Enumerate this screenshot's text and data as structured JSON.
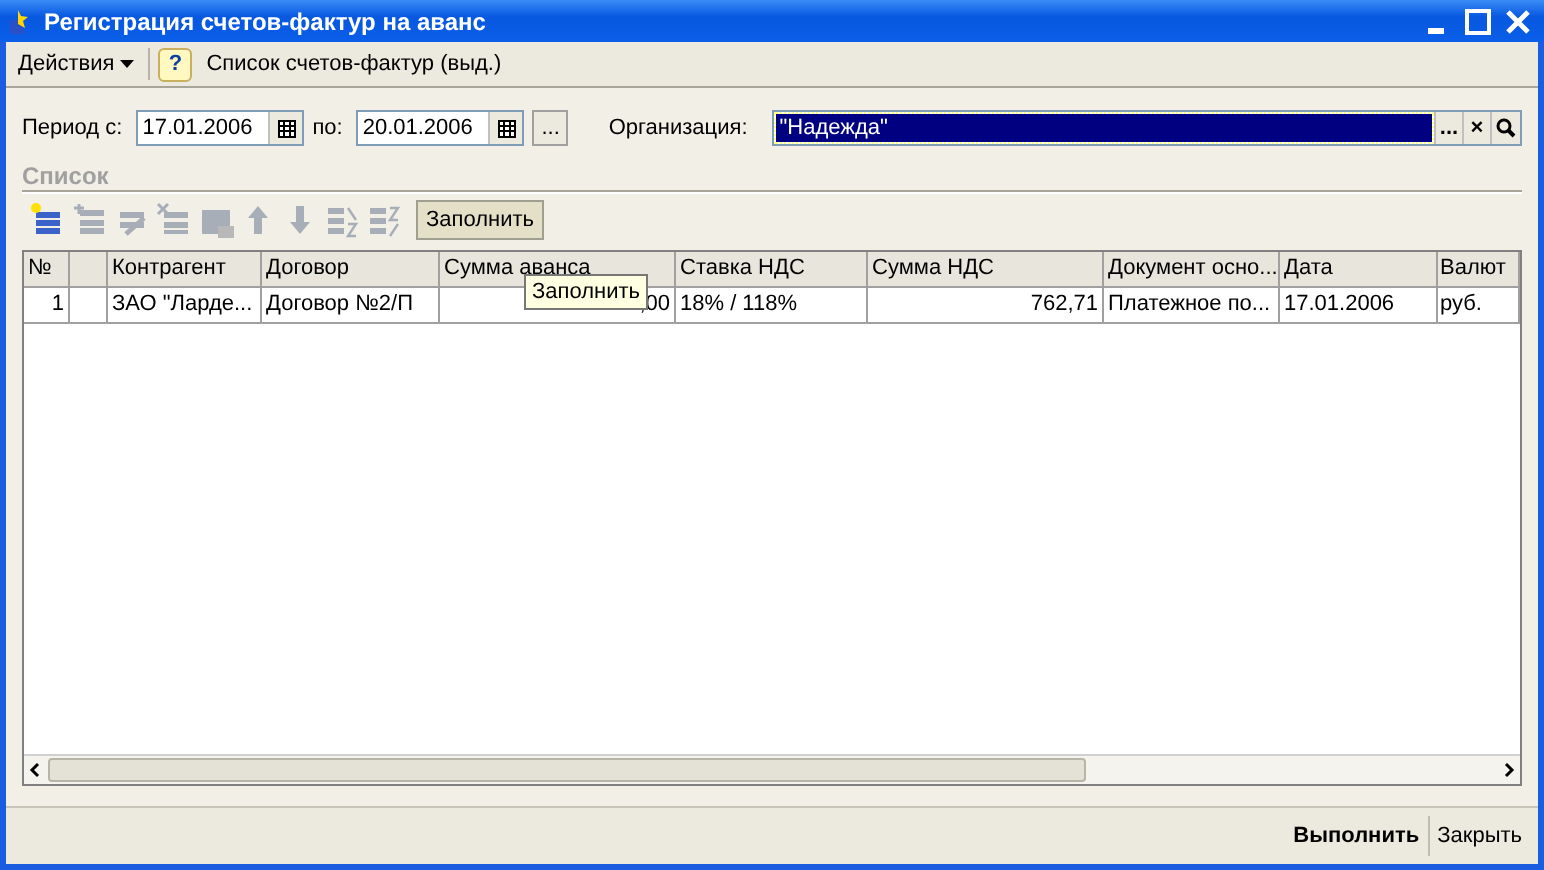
{
  "window": {
    "title": "Регистрация счетов-фактур на аванс"
  },
  "menu": {
    "actions": "Действия",
    "help": "?",
    "list_link": "Список счетов-фактур (выд.)"
  },
  "filter": {
    "period_from_label": "Период с:",
    "period_from": "17.01.2006",
    "period_to_label": "по:",
    "period_to": "20.01.2006",
    "choose_button": "...",
    "org_label": "Организация:",
    "org_value": "\"Надежда\"",
    "org_focused": true,
    "org_choose": "...",
    "org_clear": "×"
  },
  "list": {
    "title": "Список",
    "toolbar": [
      {
        "kind": "add",
        "disabled": false
      },
      {
        "kind": "copy",
        "disabled": true
      },
      {
        "kind": "edit",
        "disabled": true
      },
      {
        "kind": "delete",
        "disabled": true
      },
      {
        "kind": "post",
        "disabled": true
      },
      {
        "kind": "up",
        "disabled": true
      },
      {
        "kind": "down",
        "disabled": true
      },
      {
        "kind": "sort-asc",
        "disabled": true
      },
      {
        "kind": "sort-desc",
        "disabled": true
      }
    ],
    "fill_button": "Заполнить",
    "tooltip": "Заполнить",
    "columns": [
      "№",
      "",
      "Контрагент",
      "Договор",
      "Сумма аванса",
      "Ставка НДС",
      "Сумма НДС",
      "Документ осно...",
      "Дата",
      "Валют"
    ],
    "rows": [
      {
        "selected": false,
        "cells": [
          "1",
          "",
          "ЗАО \"Ларде...",
          "Договор №2/П",
          ",00",
          "18% / 118%",
          "762,71",
          "Платежное по...",
          "17.01.2006",
          "руб."
        ]
      }
    ]
  },
  "buttons": [
    {
      "label": "Выполнить",
      "default": true
    },
    {
      "label": "Закрыть",
      "default": false
    }
  ]
}
